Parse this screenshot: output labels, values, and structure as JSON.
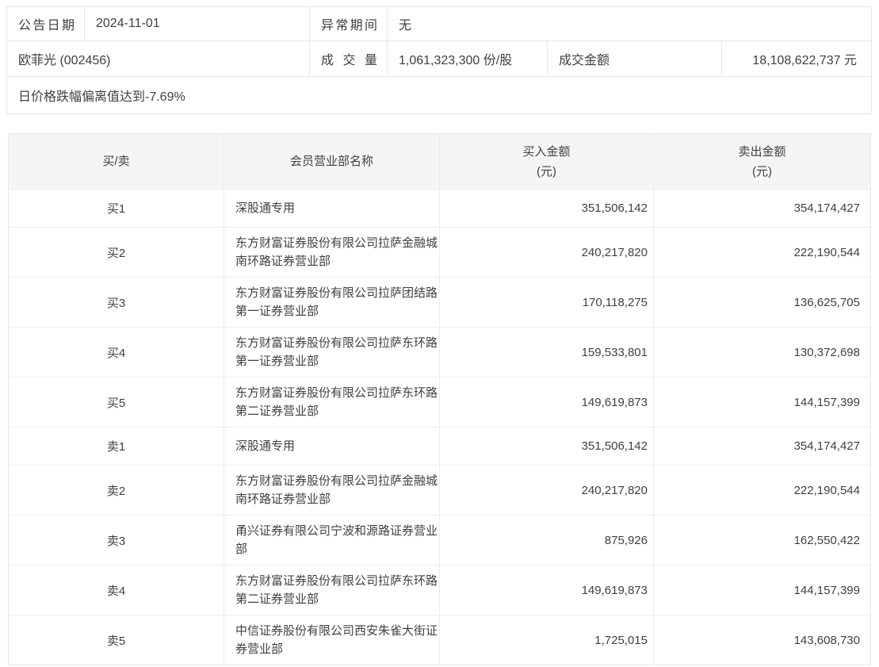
{
  "info": {
    "announce_date_label": "公告日期",
    "announce_date": "2024-11-01",
    "abnormal_period_label": "异常期间",
    "abnormal_period": "无",
    "stock_name": "欧菲光 (002456)",
    "volume_label": "成交量",
    "volume": "1,061,323,300 份/股",
    "turnover_label": "成交金额",
    "turnover": "18,108,622,737 元",
    "reason": "日价格跌幅偏离值达到-7.69%"
  },
  "table": {
    "columns": [
      {
        "label": "买/卖",
        "sub": ""
      },
      {
        "label": "会员营业部名称",
        "sub": ""
      },
      {
        "label": "买入金额",
        "sub": "(元)"
      },
      {
        "label": "卖出金额",
        "sub": "(元)"
      }
    ],
    "rows": [
      {
        "side": "买1",
        "name": "深股通专用",
        "buy": "351,506,142",
        "sell": "354,174,427"
      },
      {
        "side": "买2",
        "name": "东方财富证券股份有限公司拉萨金融城南环路证券营业部",
        "buy": "240,217,820",
        "sell": "222,190,544"
      },
      {
        "side": "买3",
        "name": "东方财富证券股份有限公司拉萨团结路第一证券营业部",
        "buy": "170,118,275",
        "sell": "136,625,705"
      },
      {
        "side": "买4",
        "name": "东方财富证券股份有限公司拉萨东环路第一证券营业部",
        "buy": "159,533,801",
        "sell": "130,372,698"
      },
      {
        "side": "买5",
        "name": "东方财富证券股份有限公司拉萨东环路第二证券营业部",
        "buy": "149,619,873",
        "sell": "144,157,399"
      },
      {
        "side": "卖1",
        "name": "深股通专用",
        "buy": "351,506,142",
        "sell": "354,174,427"
      },
      {
        "side": "卖2",
        "name": "东方财富证券股份有限公司拉萨金融城南环路证券营业部",
        "buy": "240,217,820",
        "sell": "222,190,544"
      },
      {
        "side": "卖3",
        "name": "甬兴证券有限公司宁波和源路证券营业部",
        "buy": "875,926",
        "sell": "162,550,422"
      },
      {
        "side": "卖4",
        "name": "东方财富证券股份有限公司拉萨东环路第二证券营业部",
        "buy": "149,619,873",
        "sell": "144,157,399"
      },
      {
        "side": "卖5",
        "name": "中信证券股份有限公司西安朱雀大街证券营业部",
        "buy": "1,725,015",
        "sell": "143,608,730"
      }
    ]
  },
  "colors": {
    "text": "#3f3f3f",
    "border": "#e7e7e7",
    "header_bg": "#f5f5f5"
  }
}
